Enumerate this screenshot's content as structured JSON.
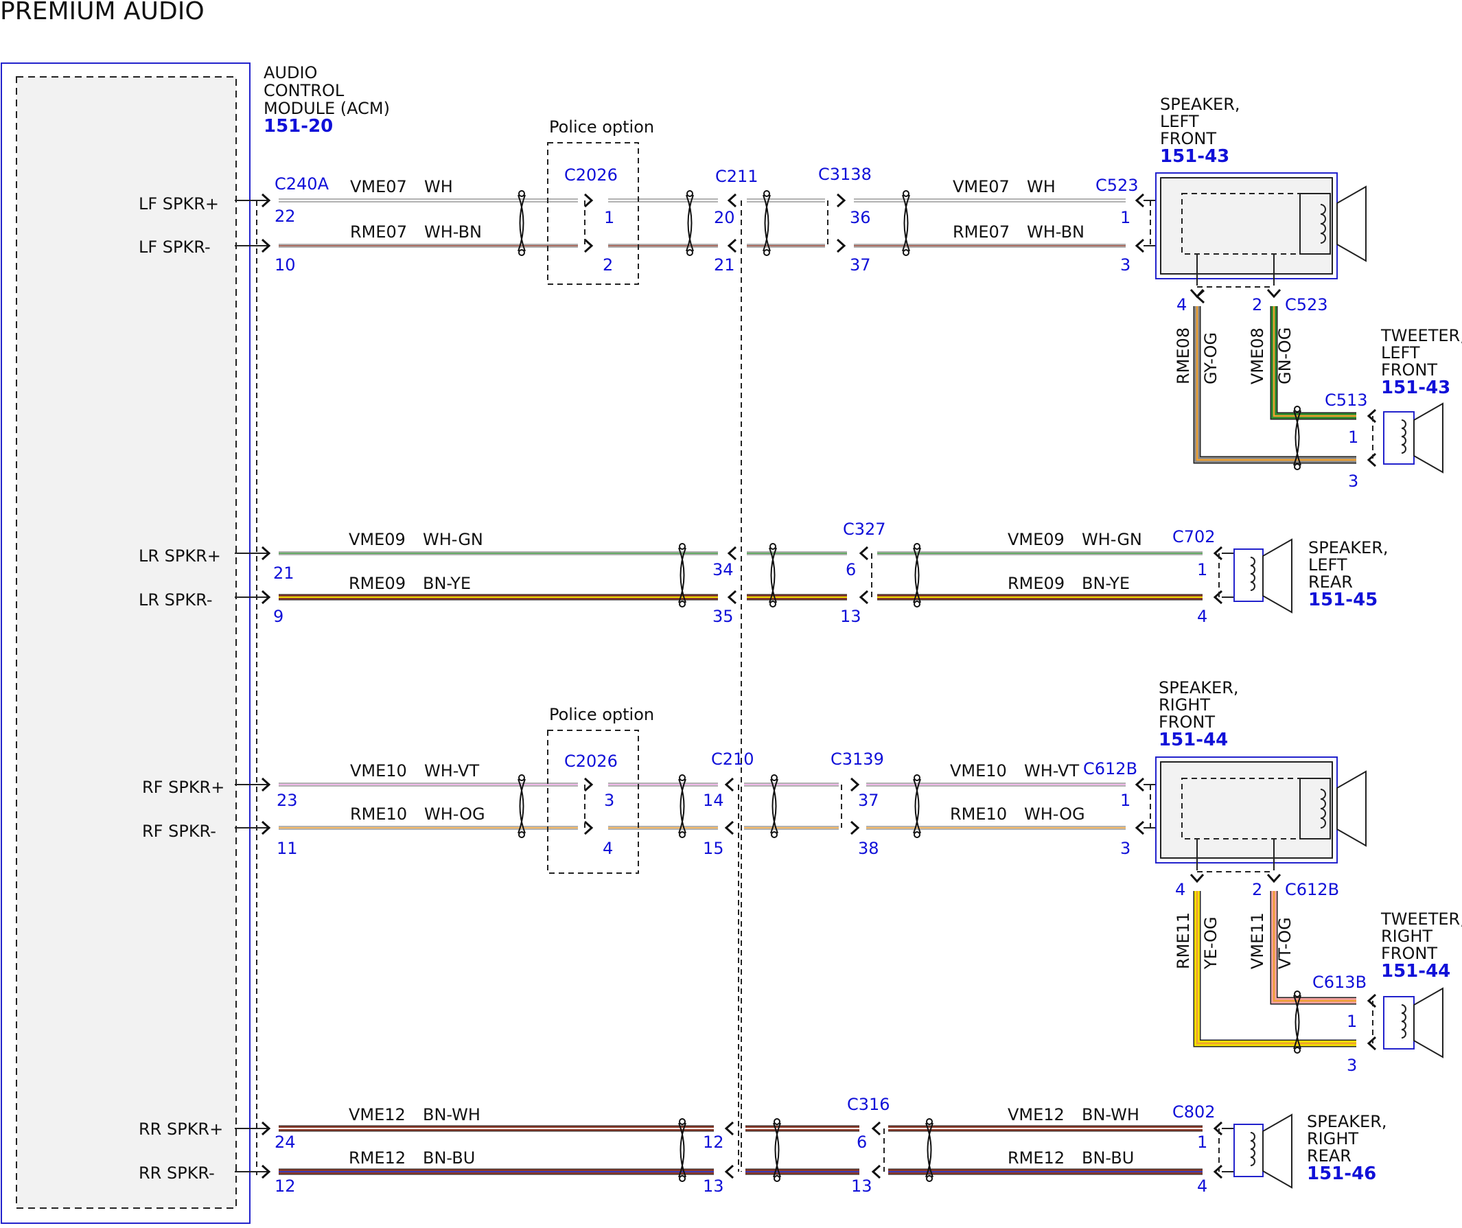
{
  "title": "PREMIUM AUDIO",
  "colors": {
    "WH": "#ffffff",
    "BN": "#8b3a2a",
    "GN": "#2e8b2e",
    "YE": "#f0e000",
    "GY": "#8a8a8a",
    "OG": "#f0a030",
    "VT": "#e8a0e0",
    "BU": "#3a3ab8",
    "PK": "#f0a0a0"
  },
  "acm": {
    "lines": [
      "AUDIO",
      "CONTROL",
      "MODULE (ACM)"
    ],
    "ref": "151-20",
    "pins": [
      {
        "label": "LF SPKR+"
      },
      {
        "label": "LF SPKR-"
      },
      {
        "label": "LR SPKR+"
      },
      {
        "label": "LR SPKR-"
      },
      {
        "label": "RF SPKR+"
      },
      {
        "label": "RF SPKR-"
      },
      {
        "label": "RR SPKR+"
      },
      {
        "label": "RR SPKR-"
      }
    ]
  },
  "police_option": "Police option",
  "connectors": {
    "acm": "C240A",
    "police": "C2026",
    "lf_inline": "C211",
    "lf_inline2": "C3138",
    "lf_spk": "C523",
    "lf_tw": "C513",
    "lr_inline": "C327",
    "lr_spk": "C702",
    "rf_inline": "C210",
    "rf_inline2": "C3139",
    "rf_spk": "C612B",
    "rf_tw": "C613B",
    "rr_inline": "C316",
    "rr_spk": "C802"
  },
  "components": {
    "lf_speaker": {
      "lines": [
        "SPEAKER,",
        "LEFT",
        "FRONT"
      ],
      "ref": "151-43"
    },
    "lf_tweeter": {
      "lines": [
        "TWEETER,",
        "LEFT",
        "FRONT"
      ],
      "ref": "151-43"
    },
    "lr_speaker": {
      "lines": [
        "SPEAKER,",
        "LEFT",
        "REAR"
      ],
      "ref": "151-45"
    },
    "rf_speaker": {
      "lines": [
        "SPEAKER,",
        "RIGHT",
        "FRONT"
      ],
      "ref": "151-44"
    },
    "rf_tweeter": {
      "lines": [
        "TWEETER,",
        "RIGHT",
        "FRONT"
      ],
      "ref": "151-44"
    },
    "rr_speaker": {
      "lines": [
        "SPEAKER,",
        "RIGHT",
        "REAR"
      ],
      "ref": "151-46"
    }
  },
  "rows": [
    {
      "id": "lfp",
      "circuit": "VME07",
      "color": "WH",
      "c1": "WH",
      "c2": "WH",
      "pins": {
        "acm": "22",
        "police": "1",
        "inline": "20",
        "inline2": "36",
        "spk": "1"
      }
    },
    {
      "id": "lfn",
      "circuit": "RME07",
      "color": "WH-BN",
      "c1": "WH",
      "c2": "BN",
      "pins": {
        "acm": "10",
        "police": "2",
        "inline": "21",
        "inline2": "37",
        "spk": "3"
      }
    },
    {
      "id": "lrp",
      "circuit": "VME09",
      "color": "WH-GN",
      "c1": "WH",
      "c2": "GN",
      "pins": {
        "acm": "21",
        "inline": "34",
        "inline2": "6",
        "spk": "1"
      }
    },
    {
      "id": "lrn",
      "circuit": "RME09",
      "color": "BN-YE",
      "c1": "BN",
      "c2": "YE",
      "pins": {
        "acm": "9",
        "inline": "35",
        "inline2": "13",
        "spk": "4"
      }
    },
    {
      "id": "rfp",
      "circuit": "VME10",
      "color": "WH-VT",
      "c1": "WH",
      "c2": "VT",
      "pins": {
        "acm": "23",
        "police": "3",
        "inline": "14",
        "inline2": "37",
        "spk": "1"
      }
    },
    {
      "id": "rfn",
      "circuit": "RME10",
      "color": "WH-OG",
      "c1": "WH",
      "c2": "OG",
      "pins": {
        "acm": "11",
        "police": "4",
        "inline": "15",
        "inline2": "38",
        "spk": "3"
      }
    },
    {
      "id": "rrp",
      "circuit": "VME12",
      "color": "BN-WH",
      "c1": "BN",
      "c2": "WH",
      "pins": {
        "acm": "24",
        "inline": "12",
        "inline2": "6",
        "spk": "1"
      }
    },
    {
      "id": "rrn",
      "circuit": "RME12",
      "color": "BN-BU",
      "c1": "BN",
      "c2": "BU",
      "pins": {
        "acm": "12",
        "inline": "13",
        "inline2": "13",
        "spk": "4"
      }
    }
  ],
  "tweeter_wires": [
    {
      "id": "lf_tw_n",
      "circuit": "RME08",
      "color": "GY-OG",
      "c1": "GY",
      "c2": "OG",
      "spk_pin": "4",
      "tw_pin": "3"
    },
    {
      "id": "lf_tw_p",
      "circuit": "VME08",
      "color": "GN-OG",
      "c1": "GN",
      "c2": "OG",
      "spk_pin": "2",
      "tw_pin": "1"
    },
    {
      "id": "rf_tw_n",
      "circuit": "RME11",
      "color": "YE-OG",
      "c1": "YE",
      "c2": "OG",
      "spk_pin": "4",
      "tw_pin": "3"
    },
    {
      "id": "rf_tw_p",
      "circuit": "VME11",
      "color": "VT-OG",
      "c1": "PK",
      "c2": "OG",
      "spk_pin": "2",
      "tw_pin": "1"
    }
  ]
}
